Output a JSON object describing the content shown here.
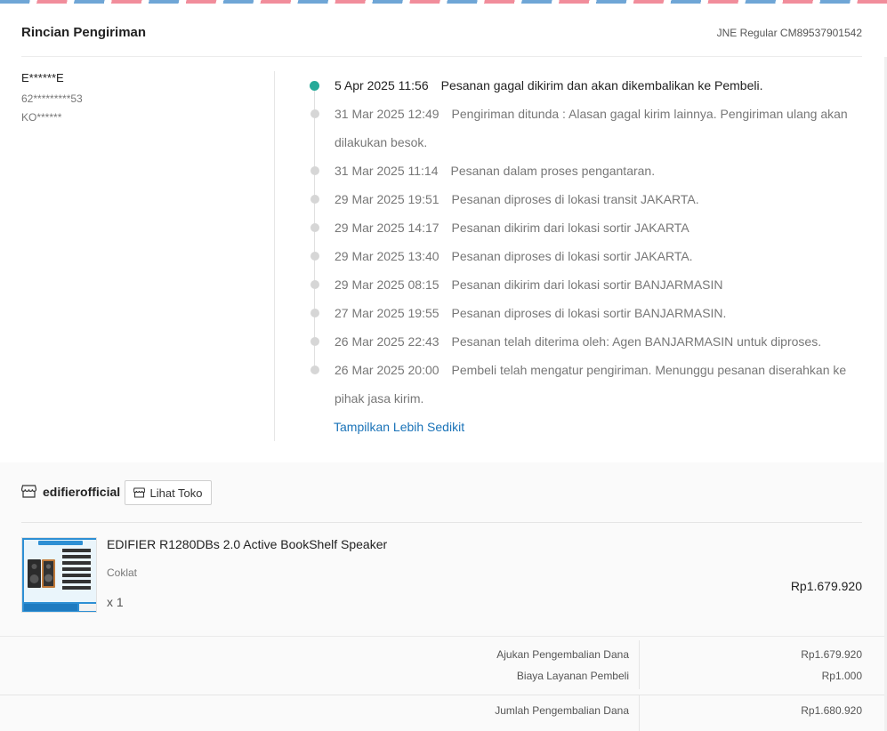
{
  "header": {
    "title": "Rincian Pengiriman",
    "carrier": "JNE Regular CM89537901542"
  },
  "address": {
    "name": "E******E",
    "phone": "62*********53",
    "location": "KO******"
  },
  "timeline": {
    "events": [
      {
        "time": "5 Apr 2025 11:56",
        "text": "Pesanan gagal dikirim dan akan dikembalikan ke Pembeli."
      },
      {
        "time": "31 Mar 2025 12:49",
        "text": "Pengiriman ditunda : Alasan gagal kirim lainnya. Pengiriman ulang akan dilakukan besok."
      },
      {
        "time": "31 Mar 2025 11:14",
        "text": "Pesanan dalam proses pengantaran."
      },
      {
        "time": "29 Mar 2025 19:51",
        "text": "Pesanan diproses di lokasi transit JAKARTA."
      },
      {
        "time": "29 Mar 2025 14:17",
        "text": "Pesanan dikirim dari lokasi sortir JAKARTA"
      },
      {
        "time": "29 Mar 2025 13:40",
        "text": "Pesanan diproses di lokasi sortir JAKARTA."
      },
      {
        "time": "29 Mar 2025 08:15",
        "text": "Pesanan dikirim dari lokasi sortir BANJARMASIN"
      },
      {
        "time": "27 Mar 2025 19:55",
        "text": "Pesanan diproses di lokasi sortir BANJARMASIN."
      },
      {
        "time": "26 Mar 2025 22:43",
        "text": "Pesanan telah diterima oleh: Agen BANJARMASIN untuk diproses."
      },
      {
        "time": "26 Mar 2025 20:00",
        "text": "Pembeli telah mengatur pengiriman. Menunggu pesanan diserahkan ke pihak jasa kirim."
      }
    ],
    "toggle_label": "Tampilkan Lebih Sedikit",
    "active_color": "#26aa99"
  },
  "shop": {
    "name": "edifierofficial",
    "view_button": "Lihat Toko"
  },
  "product": {
    "name": "EDIFIER R1280DBs 2.0 Active BookShelf Speaker",
    "variant": "Coklat",
    "quantity": "x 1",
    "price": "Rp1.679.920"
  },
  "summary": {
    "rows": [
      {
        "label": "Ajukan Pengembalian Dana",
        "value": "Rp1.679.920"
      },
      {
        "label": "Biaya Layanan Pembeli",
        "value": "Rp1.000"
      },
      {
        "label": "Jumlah Pengembalian Dana",
        "value": "Rp1.680.920"
      }
    ]
  },
  "colors": {
    "link": "#1a73b8",
    "airmail_blue": "#6fa6d6",
    "airmail_red": "#f18d9b"
  }
}
